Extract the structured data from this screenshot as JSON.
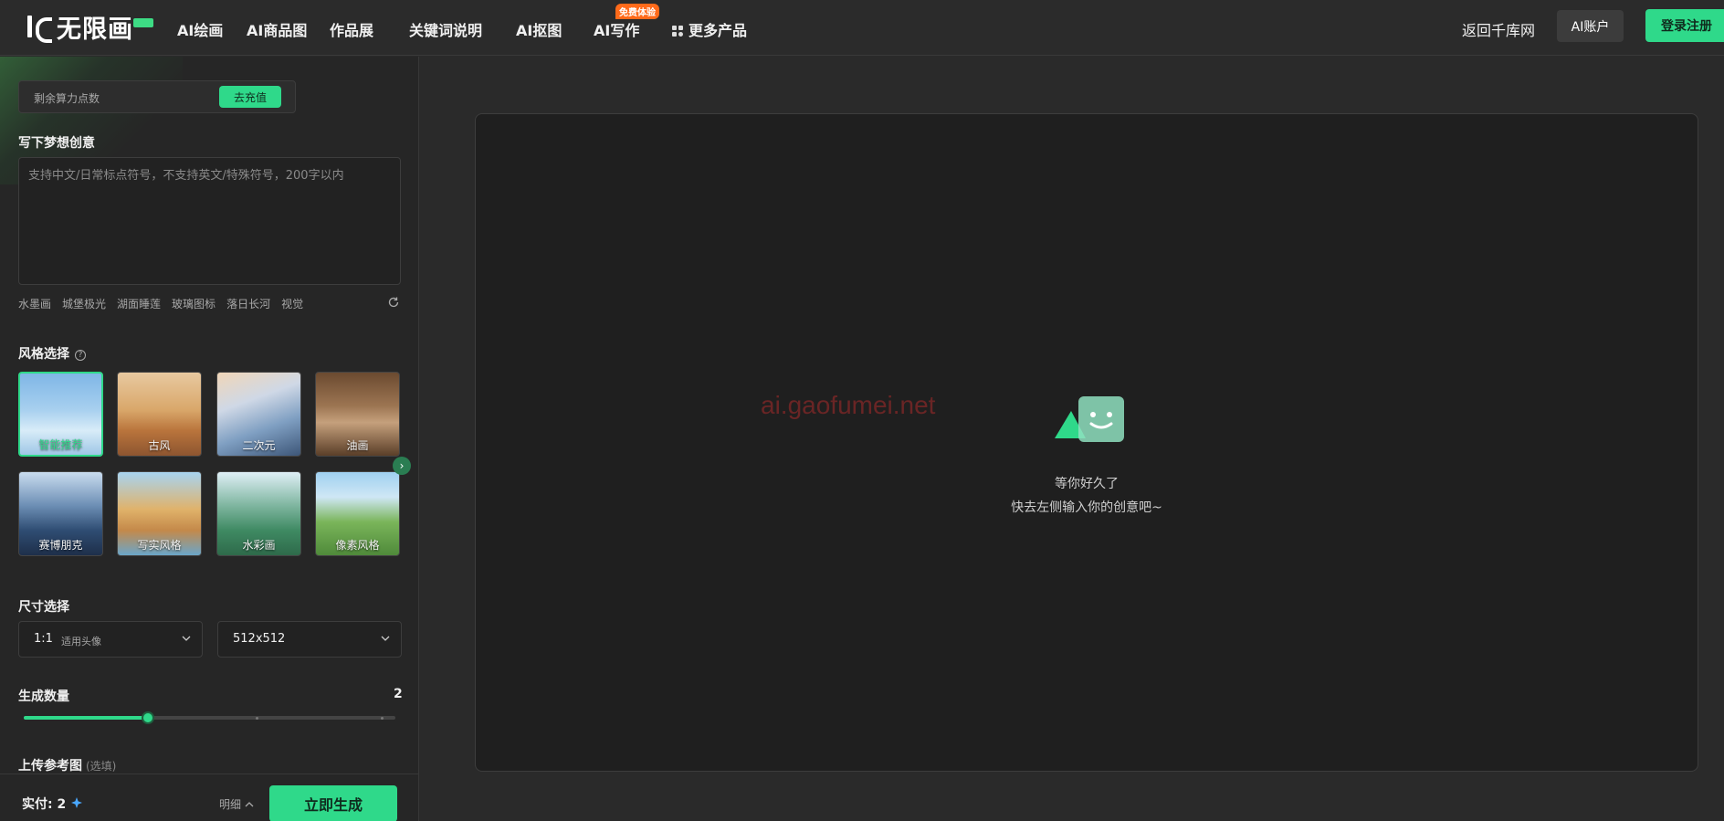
{
  "header": {
    "logo_text": "无限画",
    "nav": [
      {
        "label": "AI绘画"
      },
      {
        "label": "AI商品图"
      },
      {
        "label": "作品展"
      },
      {
        "label": "关键词说明"
      },
      {
        "label": "AI抠图"
      },
      {
        "label": "AI写作",
        "badge": "免费体验"
      },
      {
        "label": "更多产品"
      }
    ],
    "back_link": "返回千库网",
    "account_label": "AI账户",
    "register_label": "登录注册"
  },
  "sidebar": {
    "points_label": "剩余算力点数",
    "recharge_label": "去充值",
    "prompt_title": "写下梦想创意",
    "prompt_placeholder": "支持中文/日常标点符号，不支持英文/特殊符号，200字以内",
    "prompt_value": "",
    "tags": [
      "水墨画",
      "城堡极光",
      "湖面睡莲",
      "玻璃图标",
      "落日长河",
      "视觉"
    ],
    "style_title": "风格选择",
    "styles": [
      {
        "label": "智能推荐",
        "selected": true
      },
      {
        "label": "古风"
      },
      {
        "label": "二次元"
      },
      {
        "label": "油画"
      },
      {
        "label": "赛博朋克"
      },
      {
        "label": "写实风格"
      },
      {
        "label": "水彩画"
      },
      {
        "label": "像素风格"
      }
    ],
    "size_title": "尺寸选择",
    "ratio_value": "1:1",
    "ratio_hint": "适用头像",
    "resolution_value": "512x512",
    "count_title": "生成数量",
    "count_value": "2",
    "count_fraction": 0.333,
    "upload_title": "上传参考图",
    "upload_optional": "(选填)",
    "price_label": "实付:",
    "price_value": "2",
    "detail_label": "明细",
    "generate_label": "立即生成"
  },
  "canvas": {
    "empty_title": "等你好久了",
    "empty_subtitle": "快去左侧输入你的创意吧~",
    "watermark": "ai.gaofumei.net"
  },
  "colors": {
    "accent": "#2fd98a",
    "badge": "#ff6a1a",
    "panel": "#262626",
    "canvas": "#1f1f1f"
  }
}
